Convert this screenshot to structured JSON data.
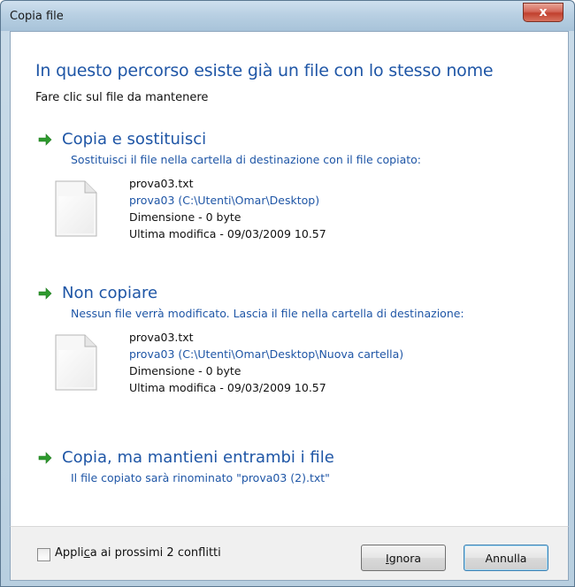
{
  "window": {
    "title": "Copia file",
    "close_glyph": "x"
  },
  "header": {
    "heading": "In questo percorso esiste già un file con lo stesso nome",
    "subheading": "Fare clic sul file da mantenere"
  },
  "options": [
    {
      "title": "Copia e sostituisci",
      "desc": "Sostituisci il file nella cartella di destinazione con il file copiato:",
      "file": {
        "name": "prova03.txt",
        "path": "prova03 (C:\\Utenti\\Omar\\Desktop)",
        "size": "Dimensione - 0 byte",
        "modified": "Ultima modifica - 09/03/2009 10.57"
      }
    },
    {
      "title": "Non copiare",
      "desc": "Nessun file verrà modificato. Lascia il file nella cartella di destinazione:",
      "file": {
        "name": "prova03.txt",
        "path": "prova03 (C:\\Utenti\\Omar\\Desktop\\Nuova cartella)",
        "size": "Dimensione - 0 byte",
        "modified": "Ultima modifica - 09/03/2009 10.57"
      }
    },
    {
      "title": "Copia, ma mantieni entrambi i file",
      "desc": "Il file copiato sarà rinominato \"prova03 (2).txt\""
    }
  ],
  "footer": {
    "checkbox_label_pre": "Appli",
    "checkbox_label_u": "c",
    "checkbox_label_post": "a ai prossimi 2 conflitti",
    "ignore_u": "I",
    "ignore_rest": "gnora",
    "cancel_label": "Annulla"
  },
  "colors": {
    "accent_blue": "#1f56a6",
    "arrow_green": "#2e9a2e",
    "close_red": "#c1402e"
  },
  "icons": [
    "arrow-right-icon",
    "document-icon",
    "close-icon"
  ]
}
